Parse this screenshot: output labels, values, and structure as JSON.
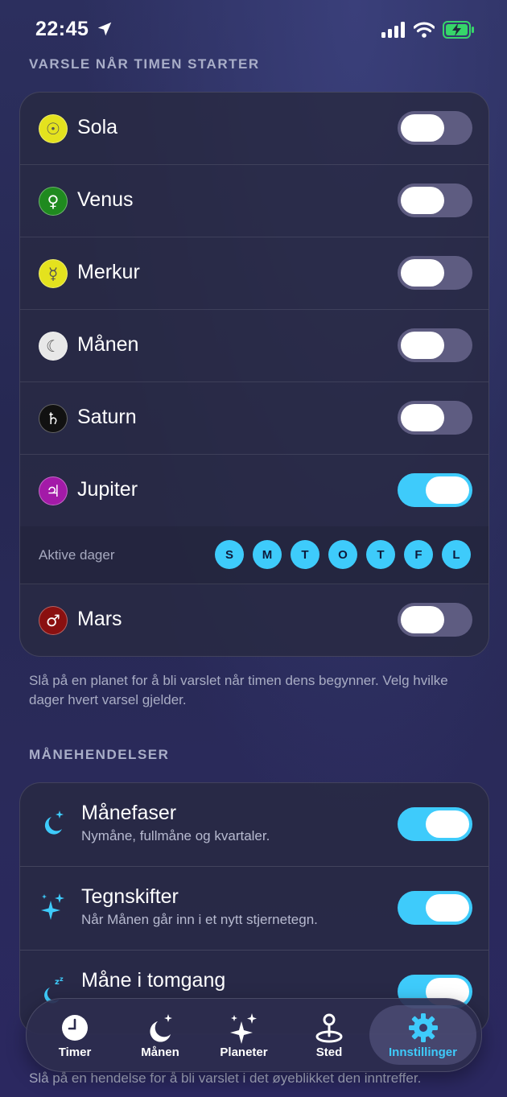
{
  "status_bar": {
    "time": "22:45",
    "colors": {
      "battery": "#36d66a"
    }
  },
  "notify_section": {
    "header": "VARSLE NÅR TIMEN STARTER",
    "planets": [
      {
        "name": "Sola",
        "symbol": "☉",
        "color": "#e4e21e",
        "toggle_on": false
      },
      {
        "name": "Venus",
        "symbol": "♀",
        "color": "#1f8a1f",
        "toggle_on": false
      },
      {
        "name": "Merkur",
        "symbol": "☿",
        "color": "#e4e21e",
        "toggle_on": false
      },
      {
        "name": "Månen",
        "symbol": "☾",
        "color": "#e8e8e8",
        "toggle_on": false
      },
      {
        "name": "Saturn",
        "symbol": "♄",
        "color": "#111111",
        "toggle_on": false
      },
      {
        "name": "Jupiter",
        "symbol": "♃",
        "color": "#a31aa8",
        "toggle_on": true
      }
    ],
    "active_days": {
      "label": "Aktive dager",
      "days": [
        "S",
        "M",
        "T",
        "O",
        "T",
        "F",
        "L"
      ]
    },
    "last_planet": {
      "name": "Mars",
      "symbol": "♂",
      "color": "#8a1010",
      "toggle_on": false
    },
    "footer": "Slå på en planet for å bli varslet når timen dens begynner. Velg hvilke dager hvert varsel gjelder."
  },
  "moon_section": {
    "header": "MÅNEHENDELSER",
    "items": [
      {
        "title": "Månefaser",
        "subtitle": "Nymåne, fullmåne og kvartaler.",
        "icon": "moon-stars-icon",
        "toggle_on": true
      },
      {
        "title": "Tegnskifter",
        "subtitle": "Når Månen går inn i et nytt stjernetegn.",
        "icon": "sparkles-icon",
        "toggle_on": true
      },
      {
        "title": "Måne i tomgang",
        "subtitle": "",
        "icon": "moon-zzz-icon",
        "toggle_on": true
      }
    ],
    "footer": "Slå på en hendelse for å bli varslet i det øyeblikket den inntreffer."
  },
  "tab_bar": {
    "tabs": [
      {
        "label": "Timer",
        "icon": "clock-icon"
      },
      {
        "label": "Månen",
        "icon": "moon-stars-icon"
      },
      {
        "label": "Planeter",
        "icon": "sparkles-icon"
      },
      {
        "label": "Sted",
        "icon": "location-pin-icon"
      },
      {
        "label": "Innstillinger",
        "icon": "gear-icon"
      }
    ],
    "active": "Innstillinger",
    "accent": "#3ecbfb"
  }
}
